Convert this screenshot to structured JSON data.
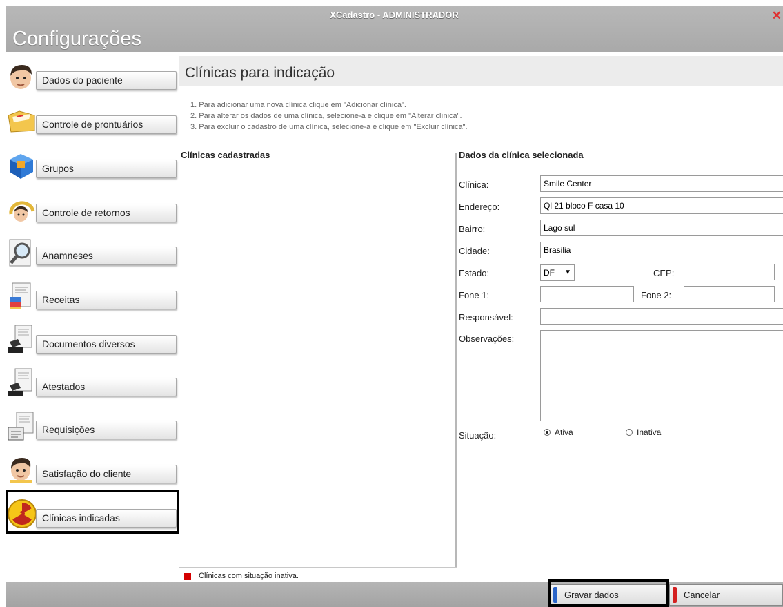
{
  "window": {
    "title": "XCadastro - ADMINISTRADOR",
    "close_glyph": "✕",
    "section_title": "Configurações"
  },
  "sidebar": {
    "items": [
      {
        "label": "Dados do paciente",
        "icon": "patient-face-icon"
      },
      {
        "label": "Controle de prontuários",
        "icon": "folder-records-icon"
      },
      {
        "label": "Grupos",
        "icon": "cube-groups-icon"
      },
      {
        "label": "Controle de retornos",
        "icon": "return-face-icon"
      },
      {
        "label": "Anamneses",
        "icon": "magnifier-icon"
      },
      {
        "label": "Receitas",
        "icon": "prescription-icon"
      },
      {
        "label": "Documentos diversos",
        "icon": "stamp-document-icon"
      },
      {
        "label": "Atestados",
        "icon": "stamp-document-icon"
      },
      {
        "label": "Requisições",
        "icon": "requisition-icon"
      },
      {
        "label": "Satisfação do cliente",
        "icon": "client-face-icon"
      },
      {
        "label": "Clínicas indicadas",
        "icon": "radiation-icon"
      }
    ],
    "selected": "Clínicas indicadas"
  },
  "content": {
    "title": "Clínicas para indicação",
    "instructions": [
      "1. Para adicionar uma nova clínica clique em \"Adicionar clínica\".",
      "2. Para alterar os dados de uma clínica, selecione-a e clique em \"Alterar clínica\".",
      "3. Para excluir o cadastro de uma clínica,  selecione-a e clique em \"Excluir clínica\"."
    ],
    "list_header": "Clínicas cadastradas",
    "legend": {
      "text": "Clínicas com situação inativa.",
      "color": "#d40000"
    },
    "detail_header": "Dados da clínica selecionada",
    "form": {
      "clinica_label": "Clínica:",
      "clinica_value": "Smile Center",
      "endereco_label": "Endereço:",
      "endereco_value": "Ql 21 bloco F casa 10",
      "bairro_label": "Bairro:",
      "bairro_value": "Lago sul",
      "cidade_label": "Cidade:",
      "cidade_value": "Brasilia",
      "estado_label": "Estado:",
      "estado_value": "DF",
      "cep_label": "CEP:",
      "cep_value": "",
      "fone1_label": "Fone 1:",
      "fone1_value": "",
      "fone2_label": "Fone 2:",
      "fone2_value": "",
      "responsavel_label": "Responsável:",
      "responsavel_value": "",
      "observacoes_label": "Observações:",
      "observacoes_value": "",
      "situacao_label": "Situação:",
      "situacao_options": [
        "Ativa",
        "Inativa"
      ],
      "situacao_selected": "Ativa"
    }
  },
  "footer": {
    "save_label": "Gravar dados",
    "save_color": "#2a64c8",
    "cancel_label": "Cancelar",
    "cancel_color": "#d42020"
  }
}
